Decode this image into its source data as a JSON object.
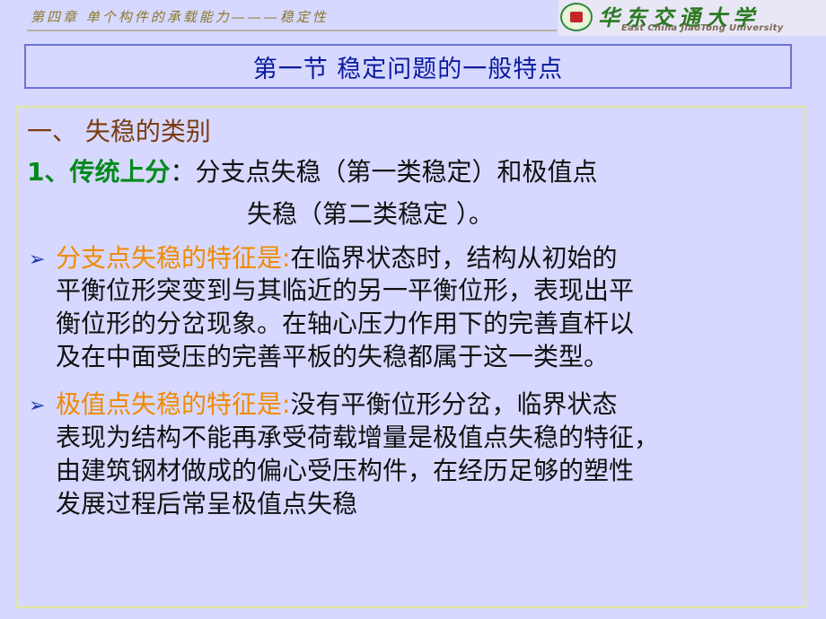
{
  "header": {
    "chapter_title": "第四章 单个构件的承载能力———稳定性",
    "logo_cn": "华东交通大学",
    "logo_en": "East China JiaoTong University"
  },
  "section": {
    "title": "第一节  稳定问题的一般特点"
  },
  "content": {
    "heading1": "一、 失稳的类别",
    "item1_label": "1、传统上分",
    "item1_colon": "：",
    "item1_text_line1": "分支点失稳（第一类稳定）和极值点",
    "item1_text_line2": "失稳（第二类稳定 ）。",
    "bullet1": {
      "marker": "➢",
      "label": "分支点失稳的特征是:",
      "line1": "在临界状态时，结构从初始的",
      "line2": "平衡位形突变到与其临近的另一平衡位形，表现出平",
      "line3": "衡位形的分岔现象。在轴心压力作用下的完善直杆以",
      "line4": "及在中面受压的完善平板的失稳都属于这一类型。"
    },
    "bullet2": {
      "marker": "➢",
      "label": "极值点失稳的特征是:",
      "line1": "没有平衡位形分岔，临界状态",
      "line2": "表现为结构不能再承受荷载增量是极值点失稳的特征，",
      "line3": "由建筑钢材做成的偏心受压构件，在经历足够的塑性",
      "line4": "发展过程后常呈极值点失稳"
    }
  }
}
